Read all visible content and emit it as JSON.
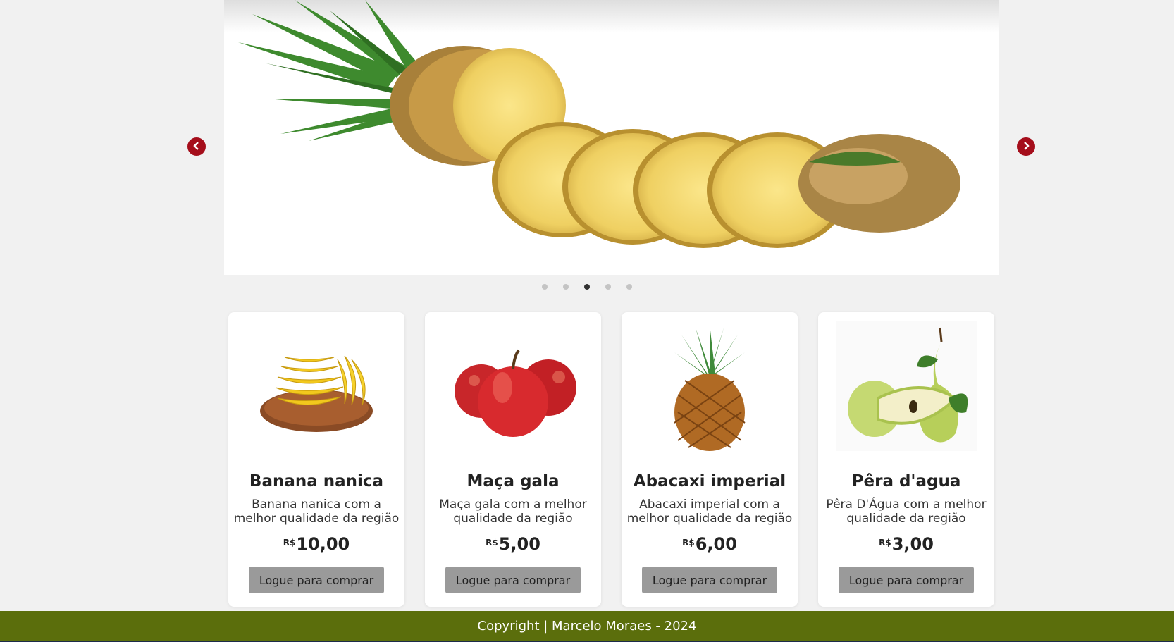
{
  "carousel": {
    "prev_icon": "chevron-left-icon",
    "next_icon": "chevron-right-icon",
    "arrow_color": "#a50e1b",
    "slide_image": "pineapple-sliced",
    "slide_count": 5,
    "active_slide": 3
  },
  "products": [
    {
      "image": "banana-bunch",
      "title": "Banana nanica",
      "description": "Banana nanica com a melhor qualidade da região",
      "currency": "R$",
      "price": "10,00",
      "button_label": "Logue para comprar"
    },
    {
      "image": "red-apples",
      "title": "Maça gala",
      "description": "Maça gala com a melhor qualidade da região",
      "currency": "R$",
      "price": "5,00",
      "button_label": "Logue para comprar"
    },
    {
      "image": "pineapple",
      "title": "Abacaxi imperial",
      "description": "Abacaxi imperial com a melhor qualidade da região",
      "currency": "R$",
      "price": "6,00",
      "button_label": "Logue para comprar"
    },
    {
      "image": "pears",
      "title": "Pêra d'agua",
      "description": "Pêra D'Água com a melhor qualidade da região",
      "currency": "R$",
      "price": "3,00",
      "button_label": "Logue para comprar"
    }
  ],
  "footer": {
    "text": "Copyright | Marcelo Moraes - 2024",
    "background": "#5b6e0c"
  }
}
